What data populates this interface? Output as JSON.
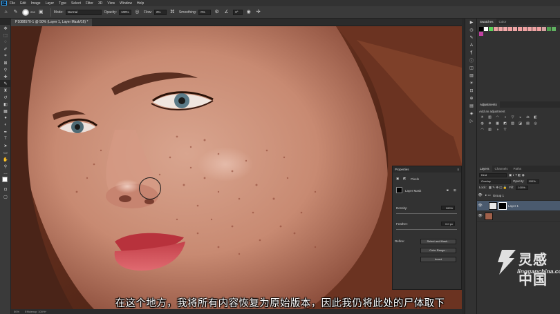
{
  "menubar": {
    "app_logo": "Ps",
    "items": [
      "File",
      "Edit",
      "Image",
      "Layer",
      "Type",
      "Select",
      "Filter",
      "3D",
      "View",
      "Window",
      "Help"
    ]
  },
  "options": {
    "brush_size": "209",
    "mode_label": "Mode:",
    "mode_value": "Normal",
    "opacity_label": "Opacity:",
    "opacity_value": "100%",
    "flow_label": "Flow:",
    "flow_value": "2%",
    "smoothing_label": "Smoothing:",
    "smoothing_value": "0%",
    "angle_value": "0°"
  },
  "document": {
    "tab_title": "P1088570-1 @ 50% (Layer 1, Layer Mask/16) *",
    "zoom": "50%",
    "efficiency": "Efficiency: 100%*"
  },
  "properties": {
    "title": "Properties",
    "type_label": "Pixels",
    "mask_label": "Layer Mask",
    "density_label": "Density:",
    "density_value": "100%",
    "feather_label": "Feather:",
    "feather_value": "0.0 px",
    "refine_label": "Refine:",
    "select_mask_button": "Select and Mask...",
    "color_range_button": "Color Range...",
    "invert_button": "Invert"
  },
  "swatches": {
    "tabs": [
      "Swatches",
      "Color"
    ],
    "colors": [
      "#000000",
      "#ffffff",
      "#5bd35b",
      "#e8a0a0",
      "#f1a6a6",
      "#f4aaaa",
      "#f1a0a0",
      "#eda6a6",
      "#f0a0a0",
      "#eea2a2",
      "#f1a6a6",
      "#eda3a3",
      "#f0a0a0",
      "#d4a0a0",
      "#50a050",
      "#60b060",
      "#c040a0"
    ]
  },
  "adjustments": {
    "title": "Adjustments",
    "add_label": "Add an adjustment",
    "icons": [
      "brightness-icon",
      "levels-icon",
      "curves-icon",
      "exposure-icon",
      "vibrance-icon",
      "hue-icon",
      "color-balance-icon",
      "bw-icon",
      "photo-filter-icon",
      "channel-mixer-icon",
      "color-lookup-icon",
      "invert-icon",
      "posterize-icon",
      "threshold-icon",
      "gradient-map-icon",
      "selective-color-icon",
      "curves2-icon",
      "levels2-icon",
      "exposure2-icon",
      "vibrance2-icon"
    ]
  },
  "layers": {
    "tabs": [
      "Layers",
      "Channels",
      "Paths"
    ],
    "kind_label": "Kind",
    "blend_mode": "Overlay",
    "opacity_label": "Opacity:",
    "opacity_value": "100%",
    "lock_label": "Lock:",
    "fill_label": "Fill:",
    "fill_value": "100%",
    "rows": [
      {
        "name": "Group 1",
        "type": "group"
      },
      {
        "name": "Layer 1",
        "type": "layer"
      }
    ]
  },
  "subtitle": "在这个地方，我将所有内容恢复为原始版本，因此我仍将此处的尸体取下",
  "watermark": {
    "cn": "灵感中国",
    "en": "lingganchina.com"
  }
}
